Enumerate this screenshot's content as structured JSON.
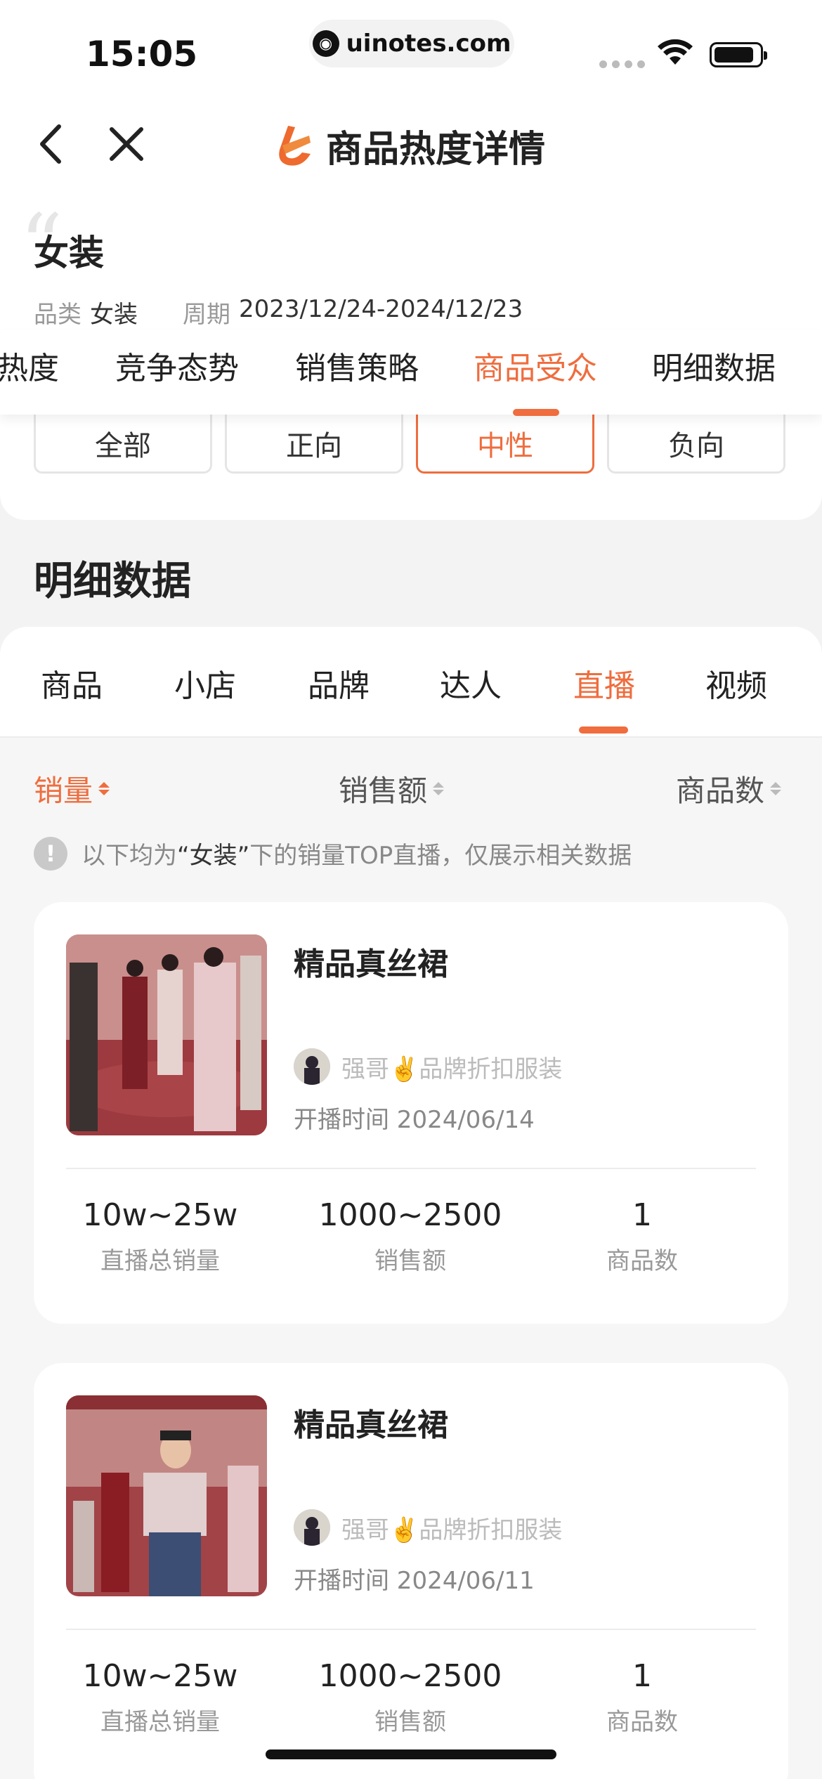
{
  "status_bar": {
    "time": "15:05",
    "url": "uinotes.com"
  },
  "nav": {
    "title": "商品热度详情"
  },
  "header": {
    "category": "女装",
    "category_label": "品类",
    "category_value": "女装",
    "period_label": "周期",
    "period_value": "2023/12/24-2024/12/23"
  },
  "main_tabs": [
    "热度",
    "竞争态势",
    "销售策略",
    "商品受众",
    "明细数据"
  ],
  "main_tab_active": "商品受众",
  "filters": [
    "全部",
    "正向",
    "中性",
    "负向"
  ],
  "filter_active": "中性",
  "section": {
    "title": "明细数据"
  },
  "sub_tabs": [
    "商品",
    "小店",
    "品牌",
    "达人",
    "直播",
    "视频"
  ],
  "sub_tab_active": "直播",
  "sort": {
    "sales": "销量",
    "amount": "销售额",
    "count": "商品数"
  },
  "notice": {
    "prefix": "以下均为",
    "keyword": "“女装”",
    "suffix": "下的销量TOP直播，仅展示相关数据"
  },
  "cards": [
    {
      "title": "精品真丝裙",
      "author": "强哥✌️品牌折扣服装",
      "start_time": "开播时间 2024/06/14",
      "stats": [
        {
          "value": "10w~25w",
          "label": "直播总销量"
        },
        {
          "value": "1000~2500",
          "label": "销售额"
        },
        {
          "value": "1",
          "label": "商品数"
        }
      ]
    },
    {
      "title": "精品真丝裙",
      "author": "强哥✌️品牌折扣服装",
      "start_time": "开播时间 2024/06/11",
      "stats": [
        {
          "value": "10w~25w",
          "label": "直播总销量"
        },
        {
          "value": "1000~2500",
          "label": "销售额"
        },
        {
          "value": "1",
          "label": "商品数"
        }
      ]
    }
  ],
  "colors": {
    "accent": "#ef6d3e"
  }
}
